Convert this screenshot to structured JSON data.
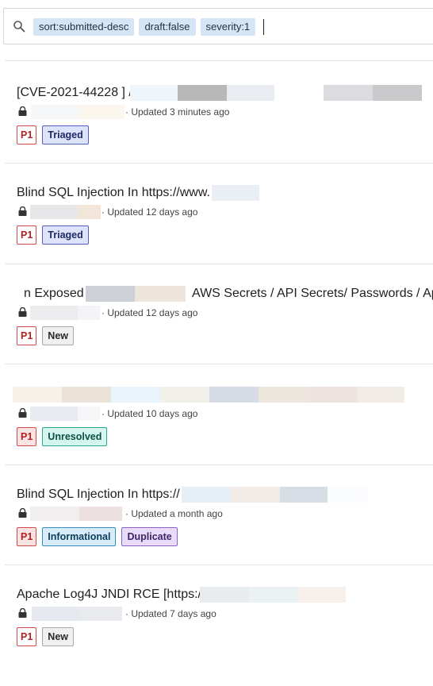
{
  "search": {
    "chips": [
      "sort:submitted-desc",
      "draft:false",
      "severity:1"
    ],
    "icon": "search-icon"
  },
  "reports": [
    {
      "title_visible": "[CVE-2021-44228 ] /",
      "updated": "· Updated 3 minutes ago",
      "badges": [
        {
          "label": "P1",
          "kind": "p1"
        },
        {
          "label": "Triaged",
          "kind": "triaged"
        }
      ]
    },
    {
      "title_visible": "Blind SQL Injection In https://www.",
      "updated": "· Updated 12 days ago",
      "badges": [
        {
          "label": "P1",
          "kind": "p1"
        },
        {
          "label": "Triaged",
          "kind": "triaged"
        }
      ]
    },
    {
      "title_prefix": "n Exposed",
      "title_visible": "AWS Secrets / API Secrets/ Passwords / Apl",
      "updated": "· Updated 12 days ago",
      "badges": [
        {
          "label": "P1",
          "kind": "p1"
        },
        {
          "label": "New",
          "kind": "new"
        }
      ]
    },
    {
      "title_visible": "",
      "updated": "· Updated 10 days ago",
      "badges": [
        {
          "label": "P1",
          "kind": "p1-pink"
        },
        {
          "label": "Unresolved",
          "kind": "unresolved"
        }
      ]
    },
    {
      "title_visible": "Blind SQL Injection In https://",
      "updated": "· Updated a month ago",
      "badges": [
        {
          "label": "P1",
          "kind": "p1-pink"
        },
        {
          "label": "Informational",
          "kind": "informational"
        },
        {
          "label": "Duplicate",
          "kind": "duplicate"
        }
      ]
    },
    {
      "title_visible": "Apache Log4J JNDI RCE [https://",
      "updated": "· Updated 7 days ago",
      "badges": [
        {
          "label": "P1",
          "kind": "p1"
        },
        {
          "label": "New",
          "kind": "new"
        }
      ]
    }
  ],
  "colors": {
    "chip_bg": "#d5e5f6",
    "triaged_bg": "#dde3fb",
    "unresolved_bg": "#d4f5ee",
    "informational_bg": "#d7ecf8",
    "duplicate_bg": "#e8dcf8"
  }
}
